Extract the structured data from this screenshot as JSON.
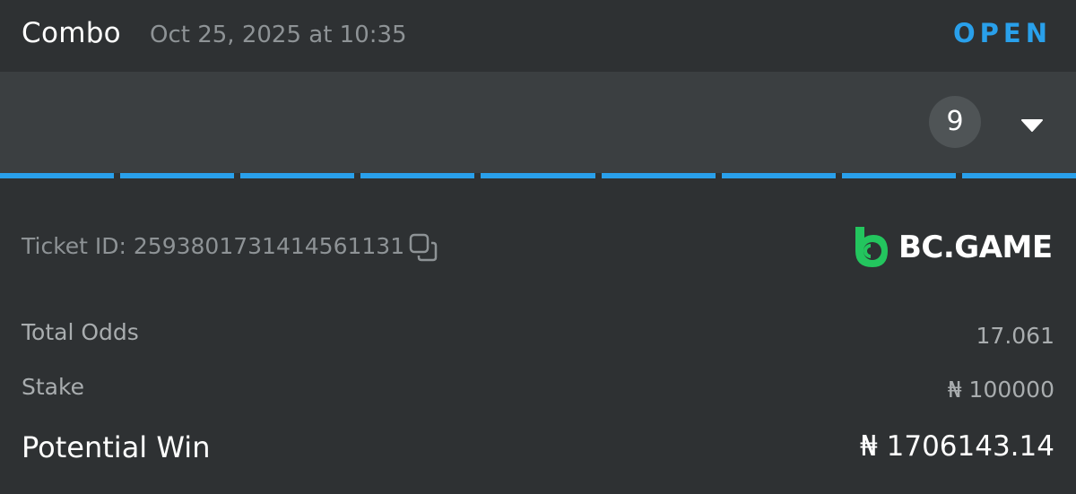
{
  "header": {
    "bet_type": "Combo",
    "datetime": "Oct 25, 2025 at 10:35",
    "status": "OPEN"
  },
  "legs": {
    "count": "9",
    "progress_segments": 9,
    "accent_color": "#29a0eb",
    "expand_icon": "caret-down-icon"
  },
  "ticket": {
    "id_text": "Ticket ID: 2593801731414561131",
    "copy_icon": "copy-icon"
  },
  "brand": {
    "name": "BC.GAME",
    "logo_color": "#23c55e"
  },
  "summary": {
    "total_odds_label": "Total Odds",
    "total_odds_value": "17.061",
    "stake_label": "Stake",
    "stake_value": "₦ 100000",
    "potential_win_label": "Potential Win",
    "potential_win_value": "₦ 1706143.14"
  }
}
